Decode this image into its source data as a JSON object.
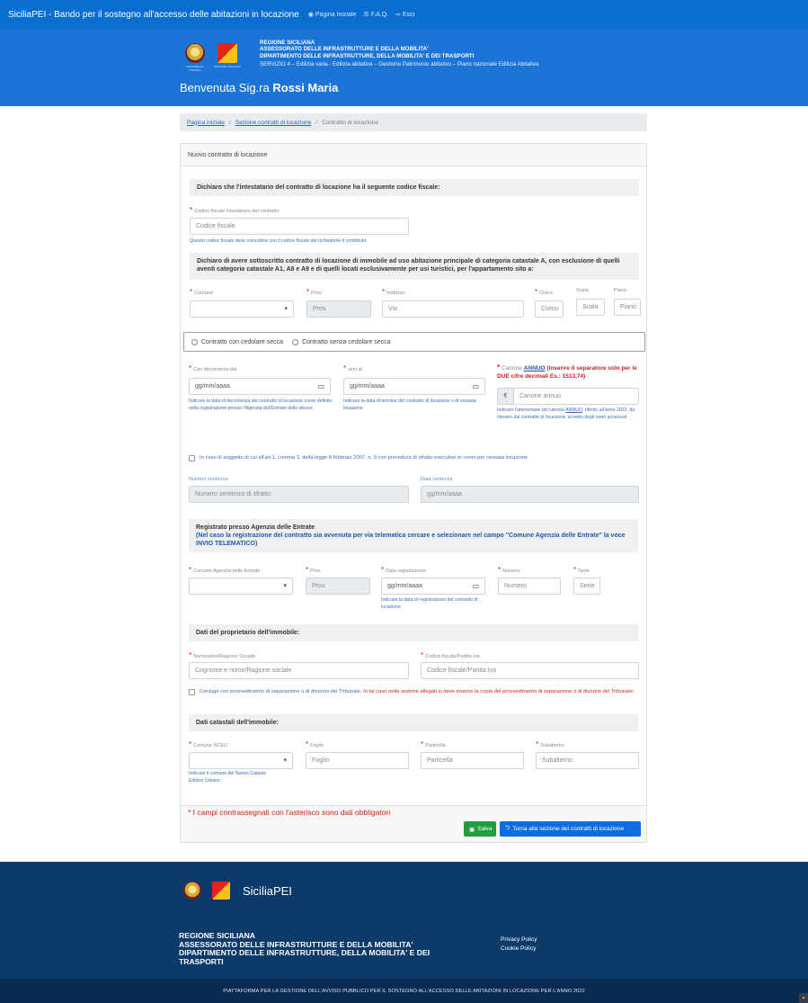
{
  "topbar": {
    "title": "SiciliaPEI - Bando per il sostegno all'accesso delle abitazioni in locazione",
    "nav": [
      {
        "icon": "dashboard-icon",
        "label": "Pagina Iniziale"
      },
      {
        "icon": "list-icon",
        "label": "F.A.Q."
      },
      {
        "icon": "logout-icon",
        "label": "Esci"
      }
    ]
  },
  "header": {
    "emblem_rep_caption": "REPUBBLICA ITALIANA",
    "emblem_sic_caption": "REGIONE SICILIANA",
    "org_line1": "REGIONE SICILIANA",
    "org_line2": "ASSESSORATO DELLE INFRASTRUTTURE E DELLA MOBILITA'",
    "org_line3": "DIPARTIMENTO DELLE INFRASTRUTTURE, DELLA MOBILITA' E DEI TRASPORTI",
    "service": "SERVIZIO 4 – Edilizia varia - Edilizia abitativa – Gestione Patrimonio abitativo – Piano nazionale Edilizia Abitativa",
    "welcome_prefix": "Benvenuta Sig.ra",
    "welcome_name": "Rossi Maria"
  },
  "breadcrumb": {
    "home": "Pagina iniziale",
    "section": "Sezione contratti di locazione",
    "current": "Contratto di locazione"
  },
  "card": {
    "title": "Nuovo contratto di locazione",
    "cf_section": "Dichiaro che l'intestatario del contratto di locazione ha il seguente codice fiscale:",
    "cf_label": "Codice fiscale intestatario del contratto",
    "cf_placeholder": "Codice fiscale",
    "cf_hint": "Questo codice fiscale deve coincidere con il codice fiscale del richiedente il contributo.",
    "immobile_section": "Dichiaro di avere sottoscritto contratto di locazione di immobile ad uso abitazione principale di categoria catastale A, con esclusione di quelli aventi categoria catastale A1, A8 e A9 e di quelli locati esclusivamente per usi turistici, per l'appartamento sito a:",
    "addr": {
      "comune_label": "Comune",
      "prov_label": "Prov.",
      "prov_placeholder": "Prov.",
      "indirizzo_label": "Indirizzo",
      "indirizzo_placeholder": "Via",
      "civico_label": "Civico",
      "civico_placeholder": "Civico",
      "scala_label": "Scala",
      "scala_placeholder": "Scala",
      "piano_label": "Piano",
      "piano_placeholder": "Piano"
    },
    "radio_cedolare": "Contratto con cedolare secca",
    "radio_no_cedolare": "Contratto senza cedolare secca",
    "decorrenza_label": "Con decorrenza dal",
    "decorrenza_value": "gg/mm/aaaa",
    "decorrenza_hint": "Indicare la data di decorrenza del contratto di locazione come definito nella registrazione presso l'Agenzia dell'Entrate dello stesso.",
    "sino_label": "sino al",
    "sino_value": "gg/mm/aaaa",
    "sino_hint": "Indicare la data di termine del contratto di locazione o di cessata locazione",
    "canone_label_prefix": "Canone ",
    "canone_label_annuo": "ANNUO",
    "canone_label_suffix": " (Inserire il separatore solo per le DUE cifre decimali Es.: 1513,74)",
    "canone_currency": "€",
    "canone_placeholder": "Canone annuo",
    "canone_hint_a": "Indicare l'ammontare del canone ",
    "canone_hint_annuo": "ANNUO",
    "canone_hint_b": ", riferito all'anno 2022, da rilevare dal contratto di locazione, al netto degli oneri accessori",
    "sfratto_check": "In caso di soggetto di cui all'art.1, comma 1, della legge 8 febbraio 2007, n. 9 con procedura di sfratto esecutivo in corso per cessata locazione",
    "numero_sentenza_label": "Numero sentenza",
    "numero_sentenza_placeholder": "Numero sentenza di sfratto",
    "data_sentenza_label": "Data sentenza",
    "data_sentenza_value": "gg/mm/aaaa",
    "registrato_title": "Registrato presso Agenzia delle Entrate",
    "registrato_note": "(Nel caso la registrazione del contratto sia avvenuta per via telematica cercare e selezionare nel campo \"Comune Agenzia delle Entrate\" la voce INVIO TELEMATICO)",
    "reg": {
      "comune_label": "Comune Agenzia delle Entrate",
      "prov_label": "Prov.",
      "prov_placeholder": "Prov.",
      "data_label": "Data registrazione",
      "data_value": "gg/mm/aaaa",
      "data_hint": "Indicare la data di registrazione del contratto di locazione",
      "numero_label": "Numero",
      "numero_placeholder": "Numero",
      "serie_label": "Serie",
      "serie_placeholder": "Serie"
    },
    "proprietario_section": "Dati del proprietario dell'immobile:",
    "nominativo_label": "Nominativo/Ragione Sociale",
    "nominativo_placeholder": "Cognome e nome/Ragione sociale",
    "cfpiva_label": "Codice fiscale/Partita Iva",
    "cfpiva_placeholder": "Codice fiscale/Partita Iva",
    "coniuge_check": "Coniuge con provvedimento di separazione o di divorzio del Tribunale.",
    "coniuge_check_red": " In tal caso nella sezione allegati si deve inserire la copia del provvedimento di separazione o di divorzio del Tribunale;",
    "catastali_section": "Dati catastali dell'immobile:",
    "cat": {
      "comune_label": "Comune NCEU",
      "comune_hint": "Indicare il comune del Nuovo Catasto Edilizio Urbano",
      "foglio_label": "Foglio",
      "foglio_placeholder": "Foglio",
      "particella_label": "Particella",
      "particella_placeholder": "Particella",
      "subalterno_label": "Subalterno",
      "subalterno_placeholder": "Subalterno"
    },
    "mandatory_note": "* I campi contrassegnati con l'asterisco sono dati obbligatori",
    "save_label": "Salva",
    "back_label": "Torna alla sezione dei contratti di locazione"
  },
  "footer": {
    "brand": "SiciliaPEI",
    "org_line1": "REGIONE SICILIANA",
    "org_line2": "ASSESSORATO DELLE INFRASTRUTTURE E DELLA MOBILITA'",
    "org_line3": "DIPARTIMENTO DELLE INFRASTRUTTURE, DELLA MOBILITA' E DEI",
    "org_line4": "TRASPORTI",
    "privacy": "Privacy Policy",
    "cookie": "Cookie Policy",
    "bottom": "PIATTAFORMA PER LA GESTIONE DELL'AVVISO PUBBLICO PER IL SOSTEGNO ALL'ACCESSO DELLE ABITAZIONI IN LOCAZIONE PER L'ANNO 2022"
  },
  "colors": {
    "primary": "#1d74d7",
    "footer": "#0c3a6a",
    "required": "#d02020",
    "save": "#1f9d3f"
  }
}
